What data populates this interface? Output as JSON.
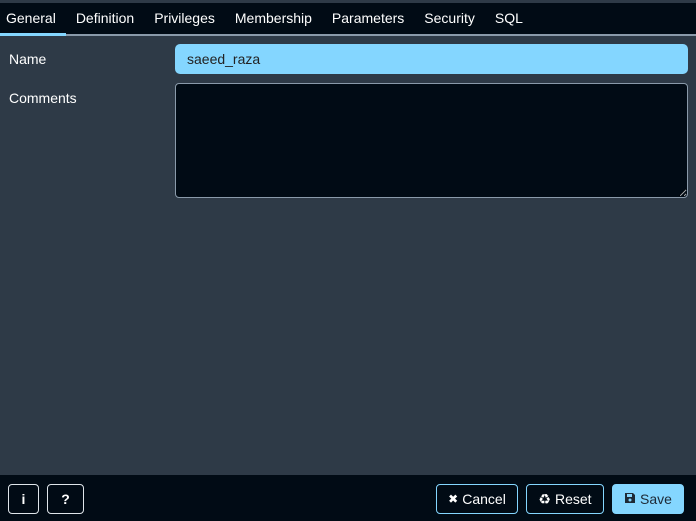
{
  "tabs": [
    {
      "label": "General",
      "active": true
    },
    {
      "label": "Definition",
      "active": false
    },
    {
      "label": "Privileges",
      "active": false
    },
    {
      "label": "Membership",
      "active": false
    },
    {
      "label": "Parameters",
      "active": false
    },
    {
      "label": "Security",
      "active": false
    },
    {
      "label": "SQL",
      "active": false
    }
  ],
  "form": {
    "name_label": "Name",
    "name_value": "saeed_raza",
    "comments_label": "Comments",
    "comments_value": ""
  },
  "footer": {
    "info_icon": "i",
    "help_icon": "?",
    "cancel_label": "Cancel",
    "cancel_icon": "✖",
    "reset_label": "Reset",
    "reset_icon": "♻",
    "save_label": "Save",
    "save_icon": "💾"
  },
  "colors": {
    "accent": "#84d6ff",
    "panel_bg": "#2e3a47",
    "dark_bg": "#010b15"
  }
}
